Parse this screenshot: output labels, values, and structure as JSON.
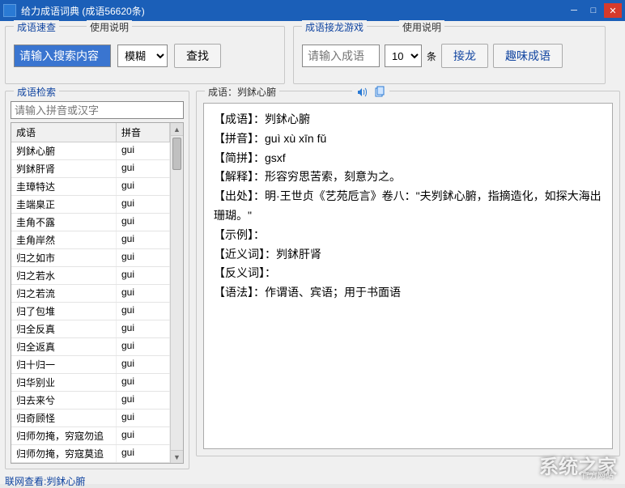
{
  "title": "给力成语词典  (成语56620条)",
  "quick_search": {
    "title": "成语速查",
    "help": "使用说明",
    "input_value": "请输入搜索内容",
    "mode": "模糊",
    "find_btn": "查找"
  },
  "chain_game": {
    "title": "成语接龙游戏",
    "help": "使用说明",
    "placeholder": "请输入成语",
    "count": "10",
    "unit": "条",
    "go_btn": "接龙",
    "fun_btn": "趣味成语"
  },
  "index": {
    "title": "成语检索",
    "search_placeholder": "请输入拼音或汉字",
    "col1": "成语",
    "col2": "拼音",
    "rows": [
      {
        "idiom": "刿鉥心腑",
        "py": "gui"
      },
      {
        "idiom": "刿鉥肝肾",
        "py": "gui"
      },
      {
        "idiom": "圭璋特达",
        "py": "gui"
      },
      {
        "idiom": "圭端臬正",
        "py": "gui"
      },
      {
        "idiom": "圭角不露",
        "py": "gui"
      },
      {
        "idiom": "圭角岸然",
        "py": "gui"
      },
      {
        "idiom": "归之如市",
        "py": "gui"
      },
      {
        "idiom": "归之若水",
        "py": "gui"
      },
      {
        "idiom": "归之若流",
        "py": "gui"
      },
      {
        "idiom": "归了包堆",
        "py": "gui"
      },
      {
        "idiom": "归全反真",
        "py": "gui"
      },
      {
        "idiom": "归全返真",
        "py": "gui"
      },
      {
        "idiom": "归十归一",
        "py": "gui"
      },
      {
        "idiom": "归华别业",
        "py": "gui"
      },
      {
        "idiom": "归去来兮",
        "py": "gui"
      },
      {
        "idiom": "归奇顾怪",
        "py": "gui"
      },
      {
        "idiom": "归师勿掩，穷寇勿追",
        "py": "gui"
      },
      {
        "idiom": "归师勿掩，穷寇莫追",
        "py": "gui"
      }
    ]
  },
  "detail": {
    "title_prefix": "成语：",
    "title_idiom": "刿鉥心腑",
    "lines": [
      "【成语】：刿鉥心腑",
      "【拼音】：guì xù xīn fǔ",
      "【简拼】：gsxf",
      "【解释】：形容穷思苦索，刻意为之。",
      "【出处】：明·王世贞《艺苑卮言》卷八：\"夫刿鉥心腑，指摘造化，如探大海出珊瑚。\"",
      "【示例】：",
      "【近义词】：刿鉥肝肾",
      "【反义词】：",
      "【语法】：作谓语、宾语；用于书面语"
    ]
  },
  "footer": {
    "link_prefix": "联网查看:",
    "link_idiom": "刿鉥心腑"
  },
  "watermark": "系统之家",
  "watermark_sub": "官方网站"
}
